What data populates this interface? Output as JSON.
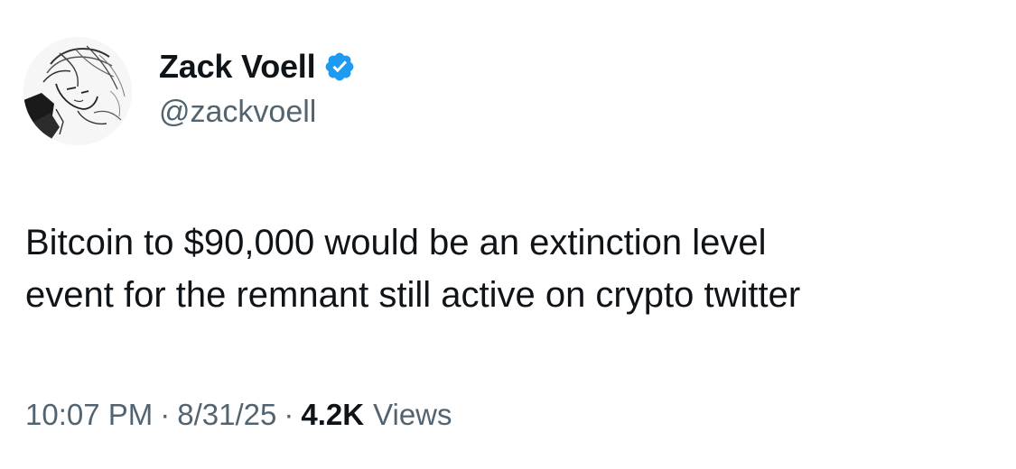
{
  "author": {
    "display_name": "Zack Voell",
    "handle": "@zackvoell",
    "verified": true,
    "verified_color": "#1d9bf0",
    "avatar_icon": "sketch-portrait-avatar"
  },
  "tweet": {
    "text_lines": [
      "Bitcoin to $90,000 would be an extinction level",
      "event for the remnant still active on crypto twitter"
    ]
  },
  "meta": {
    "time": "10:07 PM",
    "separator": "·",
    "date": "8/31/25",
    "views_count": "4.2K",
    "views_label": "Views"
  },
  "colors": {
    "text_primary": "#0f1419",
    "text_secondary": "#536471",
    "background": "#ffffff"
  }
}
